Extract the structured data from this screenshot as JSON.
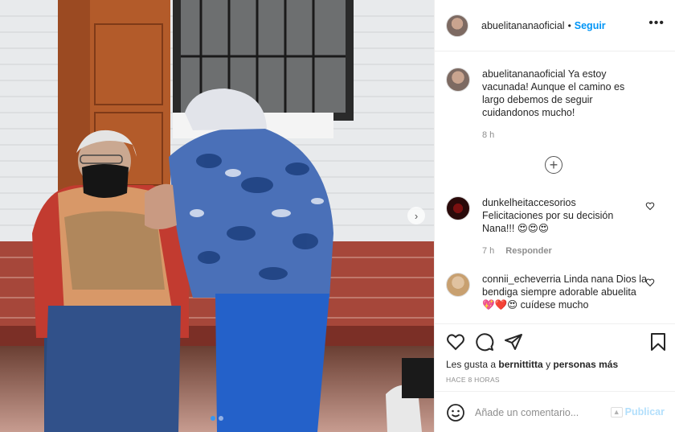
{
  "header": {
    "username": "abuelitananaoficial",
    "separator": "•",
    "follow_label": "Seguir",
    "more_icon": "more-horizontal-icon"
  },
  "caption": {
    "username": "abuelitananaoficial",
    "text": "Ya estoy vacunada! Aunque el camino es largo debemos de seguir cuidandonos mucho!",
    "time": "8 h"
  },
  "load_more_icon": "plus-circle-icon",
  "comments": [
    {
      "username": "dunkelheitaccesorios",
      "text": "Felicitaciones por su decisión Nana!!! 😍😍😍",
      "time": "7 h",
      "reply_label": "Responder"
    },
    {
      "username": "connii_echeverria",
      "text": "Linda nana Dios la bendiga siempre adorable abuelita 💖❤️😍 cuídese mucho"
    }
  ],
  "actions": {
    "icons": [
      "heart-icon",
      "comment-icon",
      "share-icon",
      "bookmark-icon"
    ],
    "likes_prefix": "Les gusta a",
    "likes_user": "bernittitta",
    "likes_mid": "y",
    "likes_others": "personas más",
    "time_ago": "HACE 8 HORAS"
  },
  "add_comment": {
    "placeholder": "Añade un comentario...",
    "publish_label": "Publicar"
  },
  "carousel": {
    "next_glyph": "›",
    "slides": 2,
    "active_slide": 1
  },
  "colors": {
    "accent": "#0095f6",
    "publish_disabled": "#b2dffc",
    "active_dot": "#3897f0"
  }
}
